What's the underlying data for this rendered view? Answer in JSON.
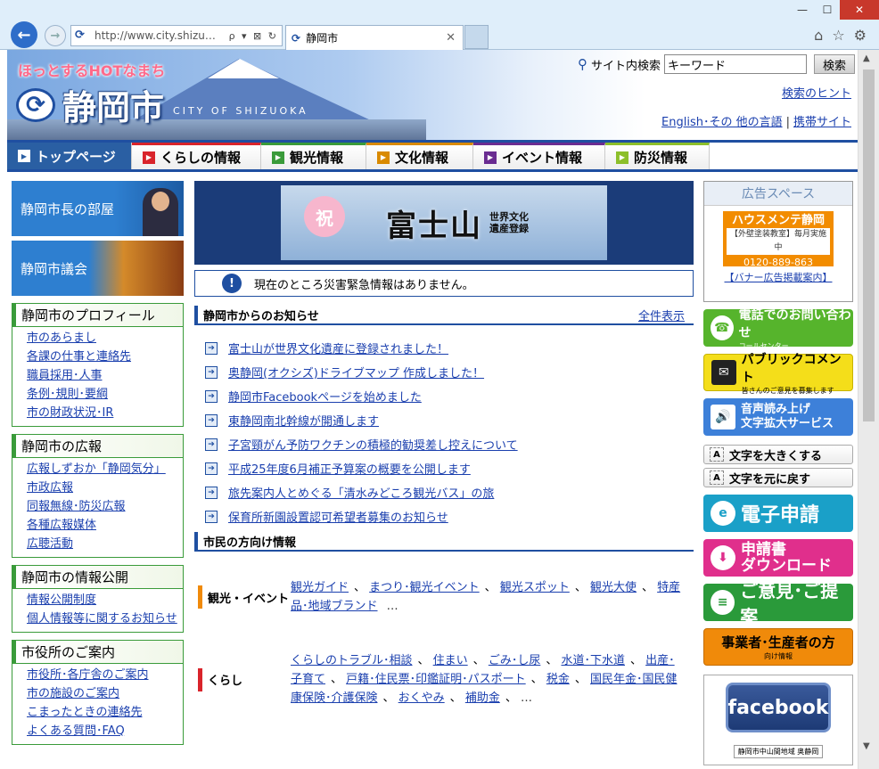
{
  "browser": {
    "url": "http://www.city.shizu…",
    "tab_title": "静岡市",
    "controls": "ρ ▾ ⊠ ↻"
  },
  "header": {
    "catchphrase": "ほっとするHOTなまち",
    "city_name": "静岡市",
    "city_name_en": "CITY OF SHIZUOKA",
    "search_label": "サイト内検索",
    "search_value": "キーワード",
    "search_button": "検索",
    "search_hint": "検索のヒント",
    "lang_link": "English･その 他の言語",
    "mobile_link": "携帯サイト"
  },
  "nav": [
    "トップページ",
    "くらしの情報",
    "観光情報",
    "文化情報",
    "イベント情報",
    "防災情報"
  ],
  "colors": {
    "primary": "#1f4fa1",
    "green": "#3a9b3a",
    "nav_lines": [
      "#2a5fa3",
      "#d9242b",
      "#3a9b3a",
      "#d98a00",
      "#6a2c91",
      "#8cbf2a"
    ]
  },
  "left": {
    "mayor_banner": "静岡市長の部屋",
    "council_banner": "静岡市議会",
    "boxes": [
      {
        "title": "静岡市のプロフィール",
        "items": [
          "市のあらまし",
          "各課の仕事と連絡先",
          "職員採用･人事",
          "条例･規則･要綱",
          "市の財政状況･IR"
        ]
      },
      {
        "title": "静岡市の広報",
        "items": [
          "広報しずおか「静岡気分」",
          "市政広報",
          "同報無線･防災広報",
          "各種広報媒体",
          "広聴活動"
        ]
      },
      {
        "title": "静岡市の情報公開",
        "items": [
          "情報公開制度",
          "個人情報等に関するお知らせ"
        ]
      },
      {
        "title": "市役所のご案内",
        "items": [
          "市役所･各庁舎のご案内",
          "市の施設のご案内",
          "こまったときの連絡先",
          "よくある質問･FAQ"
        ]
      }
    ]
  },
  "center": {
    "banner": {
      "badge": "祝",
      "main": "富士山",
      "sub1": "世界文化",
      "sub2": "遺産登録"
    },
    "alert": "現在のところ災害緊急情報はありません。",
    "news_title": "静岡市からのお知らせ",
    "news_all": "全件表示",
    "news": [
      "富士山が世界文化遺産に登録されました！",
      "奥静岡(オクシズ)ドライブマップ 作成しました！",
      "静岡市Facebookページを始めました",
      "東静岡南北幹線が開通します",
      "子宮頸がん予防ワクチンの積極的勧奨差し控えについて",
      "平成25年度6月補正予算案の概要を公開します",
      "旅先案内人とめぐる「清水みどころ観光バス」の旅",
      "保育所新園設置認可希望者募集のお知らせ"
    ],
    "citizen_title": "市民の方向け情報",
    "categories": [
      {
        "tag": "観光・イベント",
        "color": "#f08a0a",
        "links": [
          "観光ガイド",
          "まつり･観光イベント",
          "観光スポット",
          "観光大使",
          "特産品･地域ブランド"
        ],
        "more": "…"
      },
      {
        "tag": "くらし",
        "color": "#d9242b",
        "links": [
          "くらしのトラブル･相談",
          "住まい",
          "ごみ･し尿",
          "水道･下水道",
          "出産･子育て",
          "戸籍･住民票･印鑑証明･パスポート",
          "税金",
          "国民年金･国民健康保険･介護保険",
          "おくやみ",
          "補助金"
        ],
        "more": "…"
      }
    ]
  },
  "right": {
    "ad_title": "広告スペース",
    "ad_banner": {
      "name": "ハウスメンテ静岡",
      "sub": "【外壁塗装教室】毎月実施中",
      "tel": "0120-889-863"
    },
    "ad_guide": "【バナー広告掲載案内】",
    "phone": {
      "title": "電話でのお問い合わせ",
      "sub": "コールセンター"
    },
    "public_comment": {
      "title": "パブリックコメント",
      "sub": "皆さんのご意見を募集します"
    },
    "voice": {
      "line1": "音声読み上げ",
      "line2": "文字拡大サービス"
    },
    "font_large": "文字を大きくする",
    "font_reset": "文字を元に戻す",
    "eshinsei": "電子申請",
    "download": {
      "line1": "申請書",
      "line2": "ダウンロード"
    },
    "opinion": "ご意見･ご提案",
    "business": {
      "title": "事業者･生産者の方",
      "sub": "向け情報"
    },
    "facebook": "facebook",
    "facebook_caption": "静岡市中山間地域 奥静岡"
  }
}
